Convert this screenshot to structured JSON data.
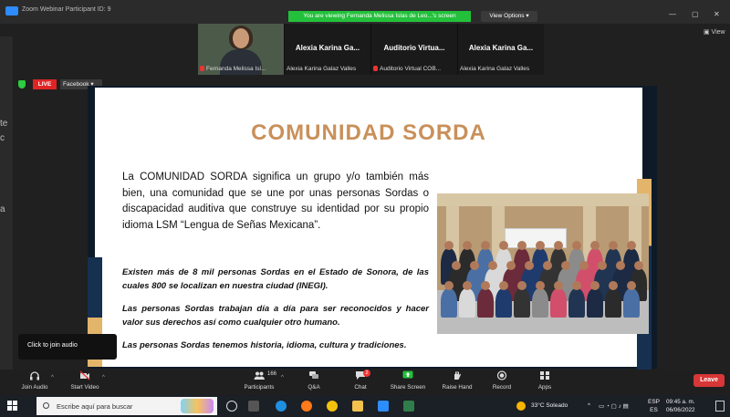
{
  "window": {
    "title": "Zoom Webinar Participant ID: 9",
    "viewing_banner": "You are viewing Fernanda Melissa Islas de Leo...'s screen",
    "view_options": "View Options ▾",
    "win_min": "—",
    "win_max": "▢",
    "win_close": "✕"
  },
  "left_fragments": [
    "te",
    "c",
    "a"
  ],
  "participants": [
    {
      "name": "",
      "label": "Fernanda Melissa Isl..."
    },
    {
      "name": "Alexia Karina Ga...",
      "label": "Alexia Karina Galaz Valles"
    },
    {
      "name": "Auditorio Virtua...",
      "label": "Auditorio Virtual COB..."
    },
    {
      "name": "Alexia Karina Ga...",
      "label": "Alexia Karina Galaz Valles"
    }
  ],
  "gallery_icon_label": "▣ View",
  "live": {
    "badge": "LIVE",
    "platform": "Facebook ▾"
  },
  "slide": {
    "title": "COMUNIDAD SORDA",
    "paragraph": "La COMUNIDAD SORDA significa un grupo y/o también más bien, una comunidad que se une por unas personas Sordas o discapacidad auditiva que construye su identidad por su propio idioma LSM “Lengua de Señas Mexicana”.",
    "bold_1": "Existen más de 8 mil personas Sordas en el Estado de Sonora, de las cuales 800 se localizan en nuestra ciudad (INEGI).",
    "bold_2": "Las personas Sordas trabajan día a día para ser reconocidos y hacer valor sus derechos así como cualquier otro humano.",
    "bold_3": "Las personas Sordas tenemos historia, idioma, cultura y tradiciones."
  },
  "tooltip": "Click to join audio",
  "toolbar": {
    "join_audio": "Join Audio",
    "start_video": "Start Video",
    "participants": "Participants",
    "participants_count": "166",
    "qa": "Q&A",
    "chat": "Chat",
    "chat_badge": "2",
    "share_screen": "Share Screen",
    "raise_hand": "Raise Hand",
    "record": "Record",
    "apps": "Apps",
    "leave": "Leave"
  },
  "taskbar": {
    "search_placeholder": "Escribe aquí para buscar",
    "weather": "33°C  Soleado",
    "lang_1": "ESP",
    "lang_2": "ES",
    "time": "09:45 a. m.",
    "date": "06/06/2022"
  },
  "colors": {
    "title_gold": "#c9905a",
    "slide_navy": "#163050",
    "live_red": "#e02424",
    "viewing_green": "#23c13b",
    "leave_red": "#d73737"
  }
}
